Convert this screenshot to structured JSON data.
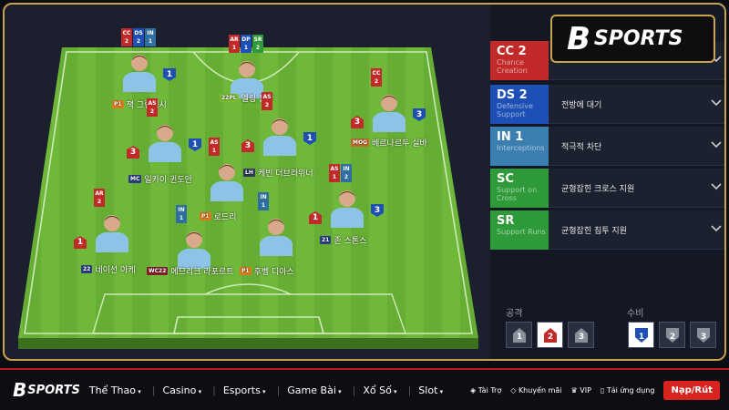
{
  "brand": {
    "mark": "B",
    "name": "SPORTS"
  },
  "players": [
    {
      "id": "grealish",
      "name": "잭 그릴리시",
      "pos": "P1",
      "pos_color": "#e07c1b",
      "stack": [
        [
          "CC",
          "2",
          "#c22a2a"
        ],
        [
          "DS",
          "2",
          "#1e4fb5"
        ],
        [
          "IN",
          "1",
          "#2f6fa0"
        ]
      ],
      "red_arrow": "",
      "blue_arrow": "1"
    },
    {
      "id": "haaland",
      "name": "엘링 홀란",
      "pos": "22PL",
      "pos_color": "#7bbf2f",
      "stack": [
        [
          "AR",
          "1",
          "#c22a2a"
        ],
        [
          "DP",
          "1",
          "#1e4fb5"
        ],
        [
          "SR",
          "2",
          "#2f9a3a"
        ]
      ],
      "red_arrow": "",
      "blue_arrow": ""
    },
    {
      "id": "bernardo",
      "name": "베르나르두 실바",
      "pos": "MOG",
      "pos_color": "#c56a2a",
      "stack": [
        [
          "CC",
          "2",
          "#c22a2a"
        ]
      ],
      "red_arrow": "3",
      "blue_arrow": "3"
    },
    {
      "id": "gundogan",
      "name": "일카이 귄도안",
      "pos": "MC",
      "pos_color": "#2b3f88",
      "stack": [
        [
          "AS",
          "2",
          "#c22a2a"
        ]
      ],
      "red_arrow": "3",
      "blue_arrow": "1"
    },
    {
      "id": "debruyne",
      "name": "케빈 더브라위너",
      "pos": "LH",
      "pos_color": "#2e3a5a",
      "stack": [
        [
          "AS",
          "2",
          "#c22a2a"
        ]
      ],
      "red_arrow": "3",
      "blue_arrow": "1"
    },
    {
      "id": "rodri",
      "name": "로드리",
      "pos": "P1",
      "pos_color": "#e07c1b",
      "stack": [
        [
          "AS",
          "1",
          "#c22a2a"
        ]
      ],
      "red_arrow": "",
      "blue_arrow": ""
    },
    {
      "id": "stones",
      "name": "존 스톤스",
      "pos": "21",
      "pos_color": "#2b3f88",
      "stack": [
        [
          "AS",
          "1",
          "#c22a2a"
        ],
        [
          "IN",
          "2",
          "#2f6fa0"
        ]
      ],
      "red_arrow": "1",
      "blue_arrow": "3"
    },
    {
      "id": "ake",
      "name": "네이선 아케",
      "pos": "22",
      "pos_color": "#2b3f88",
      "stack": [
        [
          "AR",
          "2",
          "#c22a2a"
        ]
      ],
      "red_arrow": "1",
      "blue_arrow": ""
    },
    {
      "id": "laporte",
      "name": "에므리크 라포르트",
      "pos": "WC22",
      "pos_color": "#8a1c2a",
      "stack": [
        [
          "IN",
          "1",
          "#2f6fa0"
        ]
      ],
      "red_arrow": "",
      "blue_arrow": ""
    },
    {
      "id": "dias",
      "name": "후벵 디아스",
      "pos": "P1",
      "pos_color": "#e07c1b",
      "stack": [
        [
          "IN",
          "1",
          "#2f6fa0"
        ]
      ],
      "red_arrow": "",
      "blue_arrow": ""
    }
  ],
  "instructions": [
    {
      "code": "CC 2",
      "sub1": "Chance",
      "sub2": "Creation",
      "color": "#c22a2a",
      "desc": ""
    },
    {
      "code": "DS 2",
      "sub1": "Defensive",
      "sub2": "Support",
      "color": "#1e4fb5",
      "desc": "전방에 대기"
    },
    {
      "code": "IN 1",
      "sub1": "Interceptions",
      "sub2": "",
      "color": "#3b7fb0",
      "desc": "적극적 차단"
    },
    {
      "code": "SC",
      "sub1": "Support on",
      "sub2": "Cross",
      "color": "#2f9a3a",
      "desc": "균형잡힌 크로스 지원"
    },
    {
      "code": "SR",
      "sub1": "Support Runs",
      "sub2": "",
      "color": "#2f9a3a",
      "desc": "균형잡힌 침투 지원"
    }
  ],
  "attack": {
    "label": "공격",
    "buttons": [
      "1",
      "2",
      "3"
    ],
    "active": "2"
  },
  "defense": {
    "label": "수비",
    "buttons": [
      "1",
      "2",
      "3"
    ],
    "active": "1"
  },
  "nav": {
    "logo_mark": "B",
    "logo_text": "SPORTS",
    "menu": [
      "Thể Thao",
      "Casino",
      "Esports",
      "Game Bài",
      "Xổ Số",
      "Slot"
    ],
    "utils": [
      "Tài Trợ",
      "Khuyến mãi",
      "VIP",
      "Tải ứng dụng"
    ],
    "cta": "Nạp/Rút"
  }
}
